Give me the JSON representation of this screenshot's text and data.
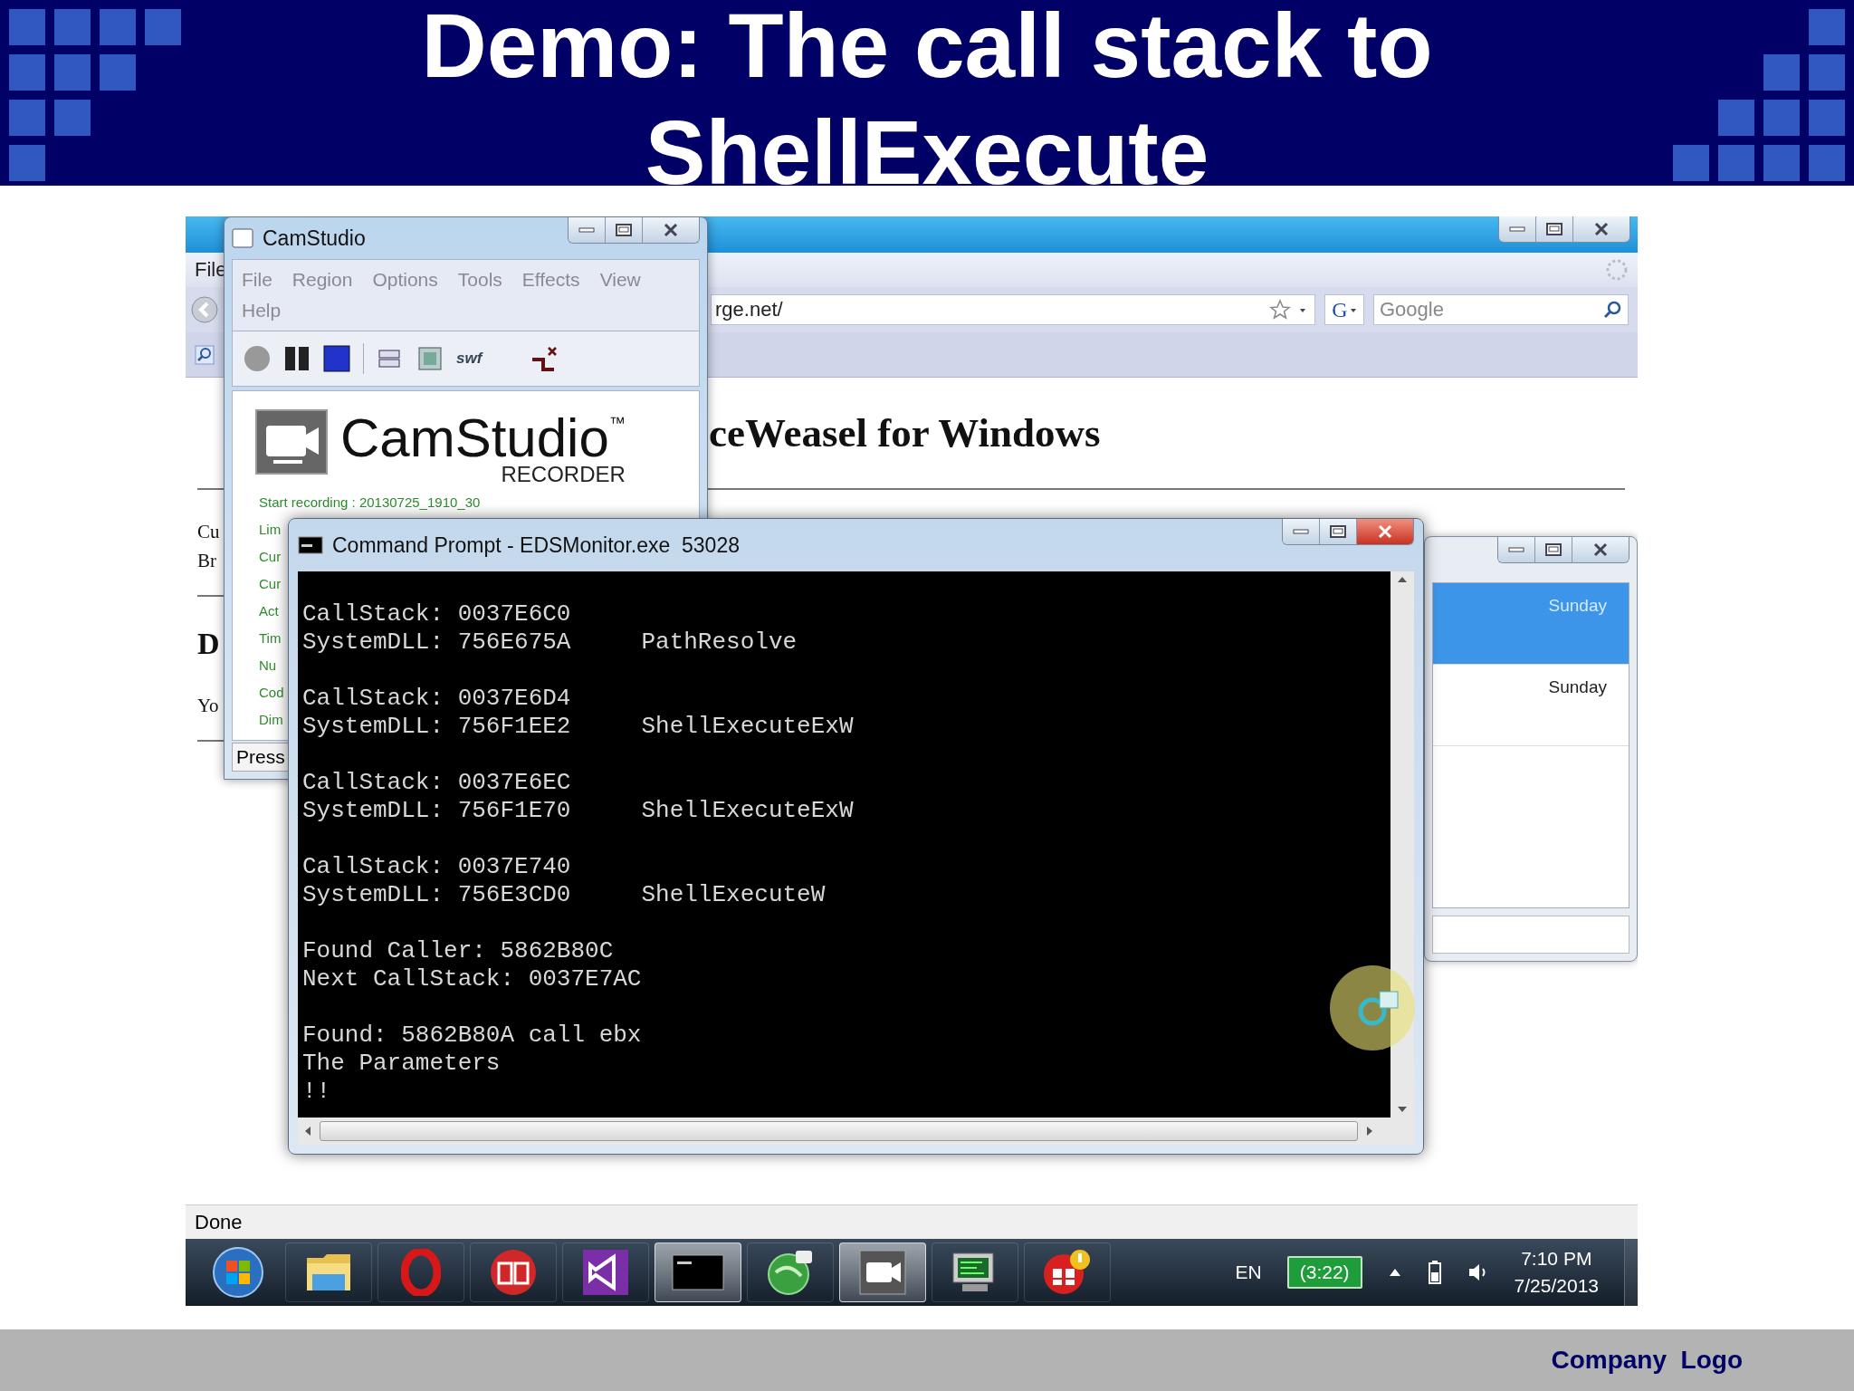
{
  "slide": {
    "title": "Demo: The call stack to ShellExecute",
    "footer": "Company  Logo"
  },
  "browser": {
    "menu": [
      "File"
    ],
    "url": "rge.net/",
    "search_engine": "G",
    "search": {
      "placeholder": "Google"
    },
    "heading": "ceWeasel for Windows",
    "sections": [
      {
        "kind": "lines",
        "lines": [
          "Cu",
          "Br"
        ]
      },
      {
        "kind": "heading",
        "text": "D"
      },
      {
        "kind": "lines",
        "lines": [
          "Yo"
        ]
      }
    ],
    "status": "Done"
  },
  "camstudio": {
    "title": "CamStudio",
    "menu": [
      "File",
      "Region",
      "Options",
      "Tools",
      "Effects",
      "View",
      "Help"
    ],
    "toolbar_label": "swf",
    "logo": {
      "name": "CamStudio",
      "mark": "™",
      "subtitle": "RECORDER"
    },
    "info_lines": [
      "Start recording : 20130725_1910_30",
      "Lim",
      "Cur",
      "Cur",
      "Act",
      "Tim",
      "Nu",
      "Cod",
      "Dim"
    ],
    "status": "Press"
  },
  "command_prompt": {
    "title": "Command Prompt - EDSMonitor.exe  53028",
    "blocks": [
      [
        "CallStack: 0037E6C0",
        "SystemDLL: 756E675A     PathResolve"
      ],
      [
        "CallStack: 0037E6D4",
        "SystemDLL: 756F1EE2     ShellExecuteExW"
      ],
      [
        "CallStack: 0037E6EC",
        "SystemDLL: 756F1E70     ShellExecuteExW"
      ],
      [
        "CallStack: 0037E740",
        "SystemDLL: 756E3CD0     ShellExecuteW"
      ],
      [
        "Found Caller: 5862B80C",
        "Next CallStack: 0037E7AC"
      ],
      [
        "Found: 5862B80A call ebx",
        "The Parameters",
        "!!"
      ]
    ]
  },
  "side_window": {
    "rows": [
      {
        "label": "Sunday",
        "selected": true
      },
      {
        "label": "Sunday",
        "selected": false
      }
    ]
  },
  "taskbar": {
    "items": [
      {
        "kind": "start",
        "selected": false
      },
      {
        "kind": "folder",
        "selected": false
      },
      {
        "kind": "ring",
        "selected": false
      },
      {
        "kind": "book",
        "selected": false
      },
      {
        "kind": "ribbon",
        "selected": false
      },
      {
        "kind": "terminal",
        "selected": true
      },
      {
        "kind": "globe",
        "selected": false
      },
      {
        "kind": "camera",
        "selected": true
      },
      {
        "kind": "monitor",
        "selected": false
      },
      {
        "kind": "alert",
        "selected": false
      }
    ],
    "language": "EN",
    "battery": "(3:22)",
    "time": "7:10 PM",
    "date": "7/25/2013"
  }
}
